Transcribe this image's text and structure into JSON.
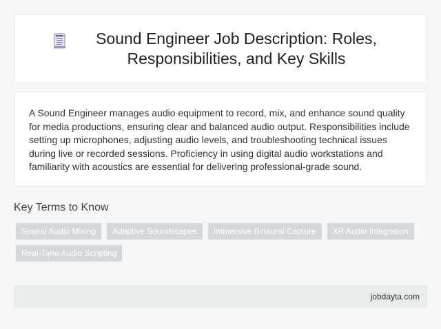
{
  "header": {
    "icon": "document-icon",
    "title": "Sound Engineer Job Description: Roles, Responsibilities, and Key Skills"
  },
  "description": "A Sound Engineer manages audio equipment to record, mix, and enhance sound quality for media productions, ensuring clear and balanced audio output. Responsibilities include setting up microphones, adjusting audio levels, and troubleshooting technical issues during live or recorded sessions. Proficiency in using digital audio workstations and familiarity with acoustics are essential for delivering professional-grade sound.",
  "key_terms": {
    "heading": "Key Terms to Know",
    "tags": [
      "Spatial Audio Mixing",
      "Adaptive Soundscapes",
      "Immersive Binaural Capture",
      "XR Audio Integration",
      "Real-Time Audio Scripting"
    ]
  },
  "footer": {
    "source": "jobdayta.com"
  },
  "colors": {
    "background": "#f4f6f7",
    "card": "#ffffff",
    "tag_bg": "#d3d8dd",
    "footer_bg": "#e8eced"
  }
}
